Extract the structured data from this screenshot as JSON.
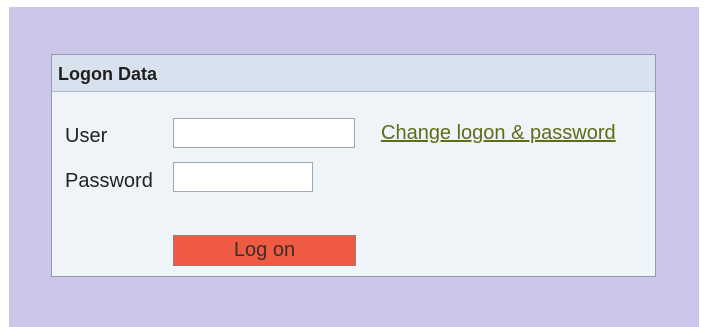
{
  "panel": {
    "title": "Logon Data"
  },
  "form": {
    "user_label": "User",
    "password_label": "Password",
    "user_value": "",
    "password_value": "",
    "change_link_text": "Change logon & password",
    "logon_button_label": "Log on"
  },
  "colors": {
    "page_background": "#cdc6ea",
    "panel_background": "#eff4f8",
    "header_background": "#d8e2ee",
    "button_background": "#ef5a42",
    "link_color": "#5a6f16"
  }
}
